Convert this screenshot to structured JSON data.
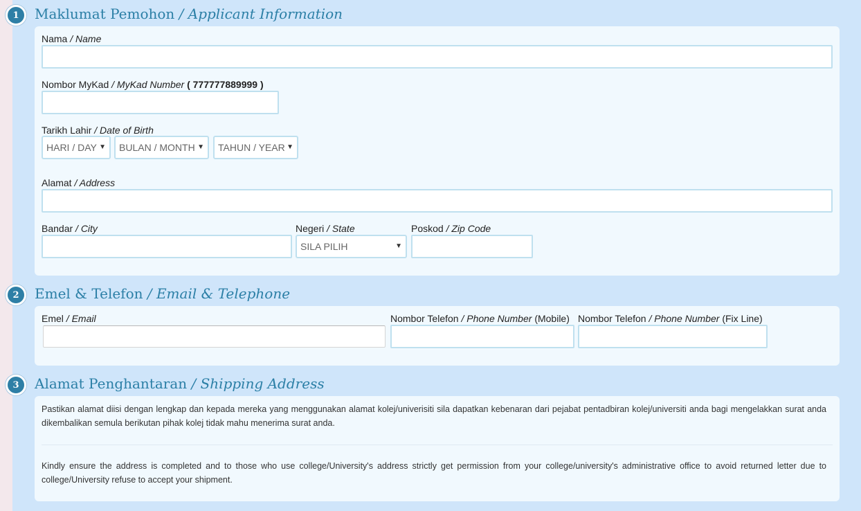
{
  "sections": {
    "applicant": {
      "number": "1",
      "title_ms": "Maklumat Pemohon",
      "title_en": "/ Applicant Information",
      "name": {
        "label_ms": "Nama",
        "label_en": "/ Name",
        "value": ""
      },
      "mykad": {
        "label_ms": "Nombor MyKad",
        "label_en": "/ MyKad Number",
        "example": "( 777777889999 )",
        "value": ""
      },
      "dob": {
        "label_ms": "Tarikh Lahir",
        "label_en": "/ Date of Birth",
        "day": "HARI / DAY",
        "month": "BULAN / MONTH",
        "year": "TAHUN / YEAR"
      },
      "address": {
        "label_ms": "Alamat",
        "label_en": "/ Address",
        "value": ""
      },
      "city": {
        "label_ms": "Bandar",
        "label_en": "/ City",
        "value": ""
      },
      "state": {
        "label_ms": "Negeri",
        "label_en": "/ State",
        "selected": "SILA PILIH"
      },
      "zip": {
        "label_ms": "Poskod",
        "label_en": "/ Zip Code",
        "value": ""
      }
    },
    "contact": {
      "number": "2",
      "title_ms": "Emel & Telefon",
      "title_en": "/ Email & Telephone",
      "email": {
        "label_ms": "Emel",
        "label_en": "/ Email",
        "value": ""
      },
      "mobile": {
        "label_ms": "Nombor Telefon",
        "label_en": "/ Phone Number",
        "suffix": "(Mobile)",
        "value": ""
      },
      "fixline": {
        "label_ms": "Nombor Telefon",
        "label_en": "/ Phone Number",
        "suffix": "(Fix Line)",
        "value": ""
      }
    },
    "shipping": {
      "number": "3",
      "title_ms": "Alamat Penghantaran",
      "title_en": "/ Shipping Address",
      "note_ms": "Pastikan alamat diisi dengan lengkap dan kepada mereka yang menggunakan alamat kolej/univerisiti sila dapatkan kebenaran dari pejabat pentadbiran kolej/universiti anda bagi mengelakkan surat anda dikembalikan semula berikutan pihak kolej tidak mahu menerima surat anda.",
      "note_en": "Kindly ensure the address is completed and to those who use college/University's address strictly get permission from your college/university's administrative office to avoid returned letter due to college/University refuse to accept your shipment."
    }
  },
  "colors": {
    "background": "#cfe5fa",
    "panel": "#f1f9fe",
    "accent": "#2b7fa6",
    "field_border": "#bfe0ef"
  },
  "icons": {
    "select_arrow": "▼"
  }
}
